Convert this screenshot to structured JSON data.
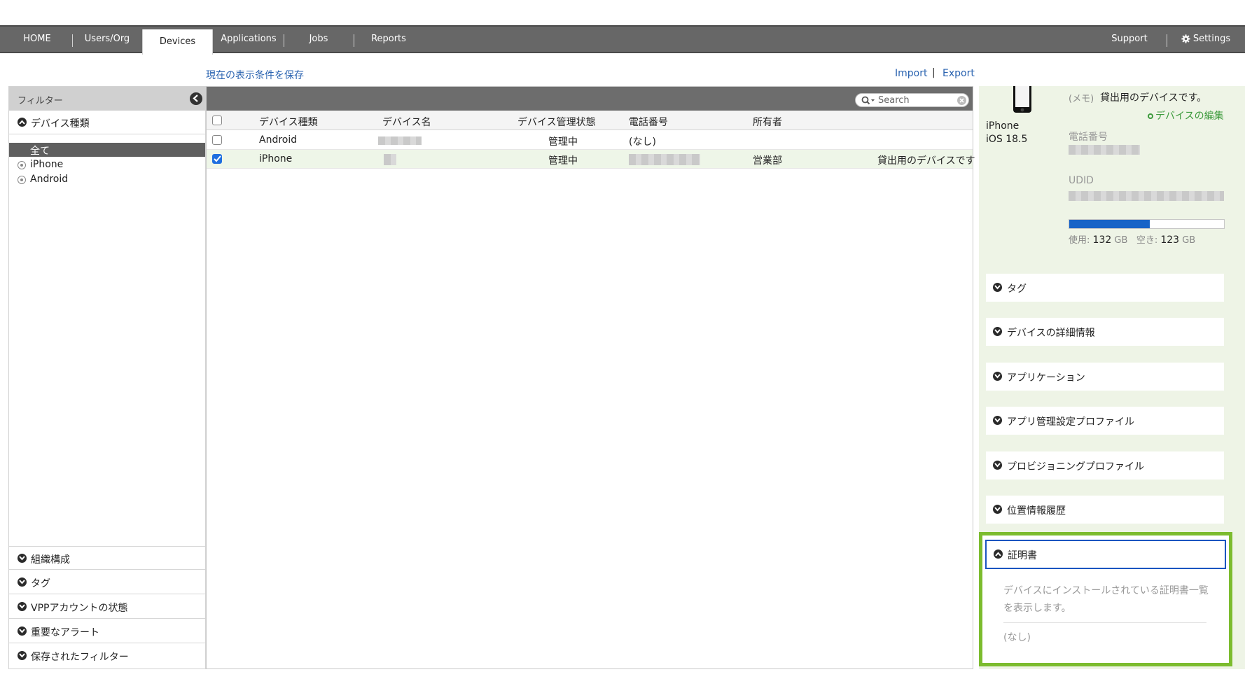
{
  "nav": {
    "items": [
      "HOME",
      "Users/Org",
      "Devices",
      "Applications",
      "Jobs",
      "Reports"
    ],
    "active": "Devices",
    "support": "Support",
    "settings": "Settings"
  },
  "links": {
    "save_view": "現在の表示条件を保存",
    "import": "Import",
    "separator": "|",
    "export": "Export"
  },
  "filter": {
    "title": "フィルター",
    "device_type_section": "デバイス種類",
    "options": {
      "all": "全て",
      "iphone": "iPhone",
      "android": "Android"
    },
    "bottom_sections": [
      "組織構成",
      "タグ",
      "VPPアカウントの状態",
      "重要なアラート",
      "保存されたフィルター"
    ]
  },
  "search": {
    "placeholder": "Search"
  },
  "table": {
    "columns": [
      "デバイス種類",
      "デバイス名",
      "デバイス管理状態",
      "電話番号",
      "所有者"
    ],
    "rows": [
      {
        "type": "Android",
        "status": "管理中",
        "phone": "(なし)",
        "owner": "",
        "memo": "",
        "checked": false
      },
      {
        "type": "iPhone",
        "status": "管理中",
        "phone": "",
        "owner": "営業部",
        "memo": "貸出用のデバイスです",
        "checked": true
      }
    ]
  },
  "detail": {
    "device_name": "iPhone",
    "os_version": "iOS 18.5",
    "memo_label": "(メモ)",
    "memo_text": "貸出用のデバイスです。",
    "edit_link": "デバイスの編集",
    "phone_label": "電話番号",
    "udid_label": "UDID",
    "storage": {
      "used_label": "使用:",
      "used_value": "132",
      "free_label": "空き:",
      "free_value": "123",
      "unit": "GB",
      "used_fraction": 0.52
    },
    "sections": [
      "タグ",
      "デバイスの詳細情報",
      "アプリケーション",
      "アプリ管理設定プロファイル",
      "プロビジョニングプロファイル",
      "位置情報履歴"
    ],
    "certificate": {
      "title": "証明書",
      "description": "デバイスにインストールされている証明書一覧を表示します。",
      "empty": "(なし)"
    }
  },
  "colors": {
    "nav_bg": "#676767",
    "link": "#2a63b0",
    "highlight_border": "#7cbc2e",
    "selected_row": "#eef6e8",
    "storage_bar": "#1763c7"
  }
}
